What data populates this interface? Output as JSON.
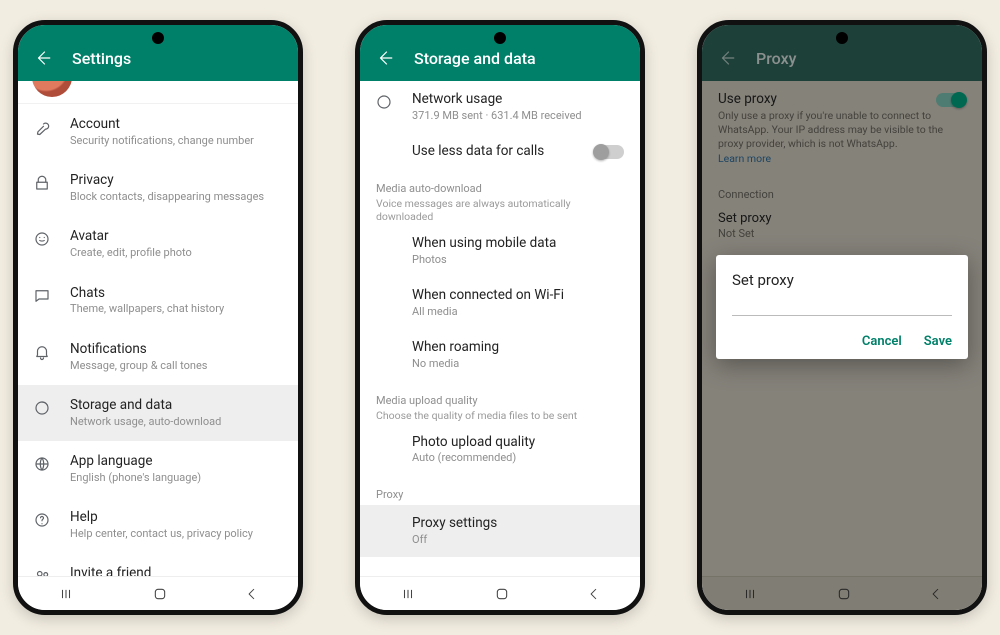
{
  "phones": {
    "settings": {
      "title": "Settings",
      "items": [
        {
          "key": "account",
          "label": "Account",
          "sub": "Security notifications, change number"
        },
        {
          "key": "privacy",
          "label": "Privacy",
          "sub": "Block contacts, disappearing messages"
        },
        {
          "key": "avatar",
          "label": "Avatar",
          "sub": "Create, edit, profile photo"
        },
        {
          "key": "chats",
          "label": "Chats",
          "sub": "Theme, wallpapers, chat history"
        },
        {
          "key": "notifications",
          "label": "Notifications",
          "sub": "Message, group & call tones"
        },
        {
          "key": "storage",
          "label": "Storage and data",
          "sub": "Network usage, auto-download"
        },
        {
          "key": "language",
          "label": "App language",
          "sub": "English (phone's language)"
        },
        {
          "key": "help",
          "label": "Help",
          "sub": "Help center, contact us, privacy policy"
        },
        {
          "key": "invite",
          "label": "Invite a friend",
          "sub": ""
        }
      ],
      "highlighted": "storage"
    },
    "storage": {
      "title": "Storage and data",
      "network": {
        "label": "Network usage",
        "sub": "371.9 MB sent · 631.4 MB received"
      },
      "lessdata": {
        "label": "Use less data for calls",
        "on": false
      },
      "mad": {
        "header": "Media auto-download",
        "note": "Voice messages are always automatically downloaded",
        "items": [
          {
            "label": "When using mobile data",
            "sub": "Photos"
          },
          {
            "label": "When connected on Wi-Fi",
            "sub": "All media"
          },
          {
            "label": "When roaming",
            "sub": "No media"
          }
        ]
      },
      "muq": {
        "header": "Media upload quality",
        "note": "Choose the quality of media files to be sent",
        "item": {
          "label": "Photo upload quality",
          "sub": "Auto (recommended)"
        }
      },
      "proxy": {
        "header": "Proxy",
        "item": {
          "label": "Proxy settings",
          "sub": "Off"
        }
      }
    },
    "proxy": {
      "title": "Proxy",
      "use": {
        "label": "Use proxy",
        "on": true
      },
      "desc": "Only use a proxy if you're unable to connect to WhatsApp. Your IP address may be visible to the proxy provider, which is not WhatsApp.",
      "learn": "Learn more",
      "connection_header": "Connection",
      "set": {
        "label": "Set proxy",
        "value": "Not Set"
      },
      "dialog": {
        "title": "Set proxy",
        "cancel": "Cancel",
        "save": "Save"
      }
    }
  },
  "nav": {
    "recents": "|||",
    "home": "◯",
    "back": "‹"
  }
}
